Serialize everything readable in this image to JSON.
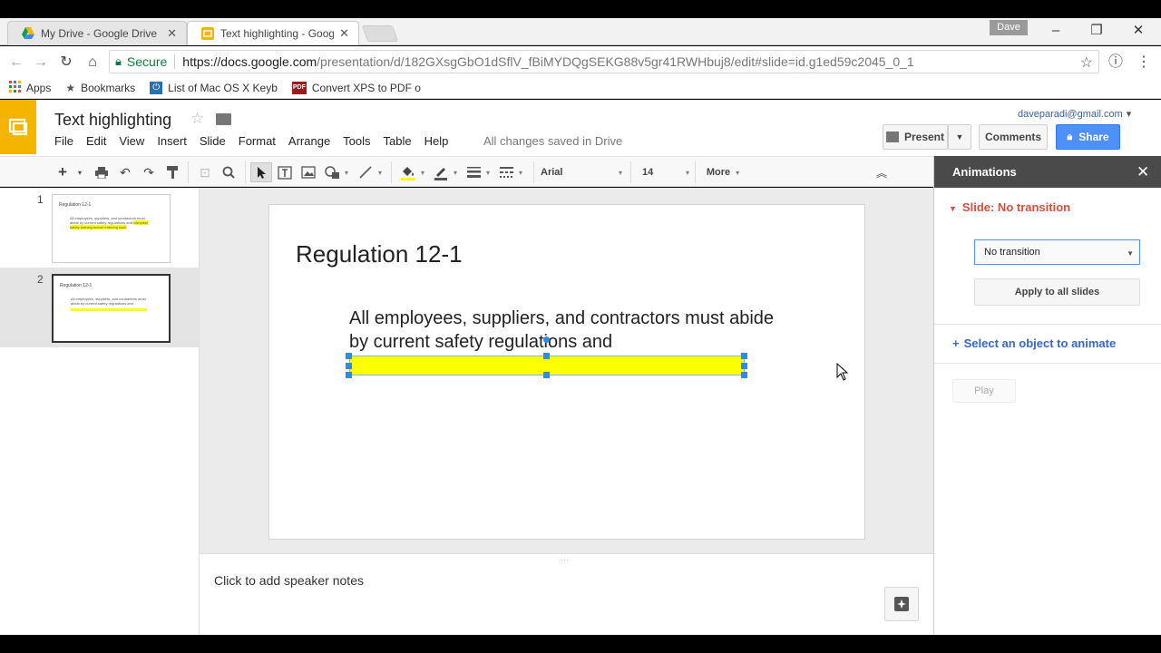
{
  "browser": {
    "tabs": [
      {
        "title": "My Drive - Google Drive",
        "close": "✕"
      },
      {
        "title": "Text highlighting - Googl",
        "close": "✕"
      }
    ],
    "profile_name": "Dave",
    "address": {
      "secure_label": "Secure",
      "url_host": "https://docs.google.com",
      "url_path": "/presentation/d/182GXsgGbO1dSflV_fBiMYDQgSEKG88v5gr41RWHbuj8/edit#slide=id.g1ed59c2045_0_1"
    },
    "bookmarks": [
      {
        "label": "Apps",
        "icon": "apps-grid-icon"
      },
      {
        "label": "Bookmarks",
        "icon": "star-icon"
      },
      {
        "label": "List of Mac OS X Keyb",
        "icon": "power-icon"
      },
      {
        "label": "Convert XPS to PDF o",
        "icon": "pdf-icon"
      }
    ]
  },
  "app": {
    "doc_title": "Text highlighting",
    "menus": [
      "File",
      "Edit",
      "View",
      "Insert",
      "Slide",
      "Format",
      "Arrange",
      "Tools",
      "Table",
      "Help"
    ],
    "save_status": "All changes saved in Drive",
    "account": "daveparadi@gmail.com",
    "present_label": "Present",
    "comments_label": "Comments",
    "share_label": "Share",
    "colors": {
      "logo": "#f4b400",
      "share": "#4d90fe",
      "highlight": "#ffff00"
    }
  },
  "toolbar": {
    "font": "Arial",
    "size": "14",
    "more": "More"
  },
  "filmstrip": [
    {
      "number": "1",
      "title": "Regulation 12-1",
      "body": "All employees, suppliers, and contractors must abide by current safety regulations and",
      "highlight": "complete safety training before entering work"
    },
    {
      "number": "2",
      "title": "Regulation 12-1",
      "body": "All employees, suppliers, and contractors must abide by current safety regulations and"
    }
  ],
  "slide": {
    "title": "Regulation 12-1",
    "body": "All employees, suppliers, and contractors must abide by current safety regulations and"
  },
  "notes": {
    "placeholder": "Click to add speaker notes"
  },
  "animations": {
    "panel_title": "Animations",
    "transition_header": "Slide: No transition",
    "transition_value": "No transition",
    "apply_label": "Apply to all slides",
    "select_object": "Select an object to animate",
    "play_label": "Play"
  }
}
